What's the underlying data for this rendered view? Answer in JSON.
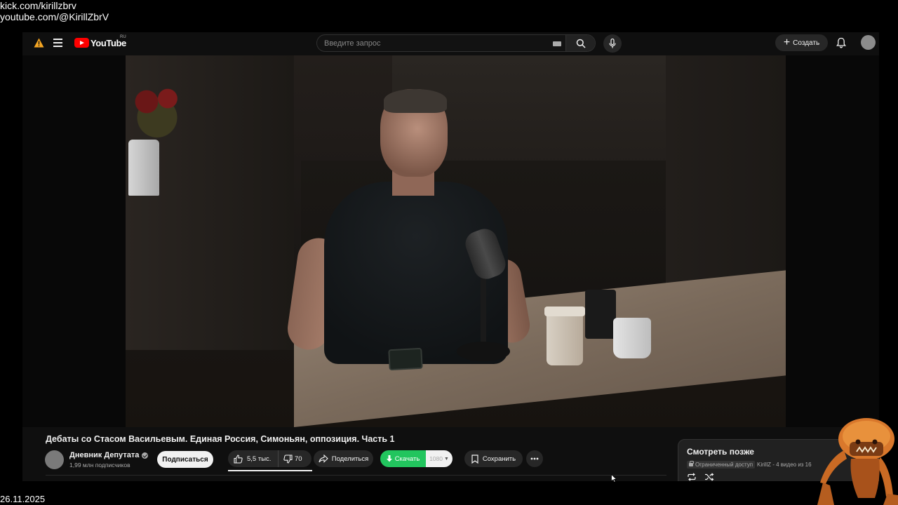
{
  "overlay": {
    "line1": "kick.com/kirillzbrv",
    "line2": "youtube.com/@KirillZbrV",
    "date": "26.11.2025"
  },
  "header": {
    "logo_text": "YouTube",
    "region": "RU",
    "search_placeholder": "Введите запрос",
    "create_label": "Создать"
  },
  "video": {
    "title": "Дебаты со Стасом Васильевым. Единая Россия, Симоньян, оппозиция. Часть 1"
  },
  "channel": {
    "name": "Дневник Депутата",
    "subscribers": "1,99 млн подписчиков",
    "subscribe_label": "Подписаться"
  },
  "actions": {
    "likes": "5,5 тыс.",
    "dislikes": "70",
    "share_label": "Поделиться",
    "download_label": "Скачать",
    "quality": "1080",
    "save_label": "Сохранить"
  },
  "playlist": {
    "title": "Смотреть позже",
    "access": "Ограниченный доступ",
    "owner_info": "KirillZ - 4 видео из 16"
  },
  "colors": {
    "accent_red": "#ff0000",
    "download_green": "#22c55e",
    "background": "#0f0f0f"
  }
}
